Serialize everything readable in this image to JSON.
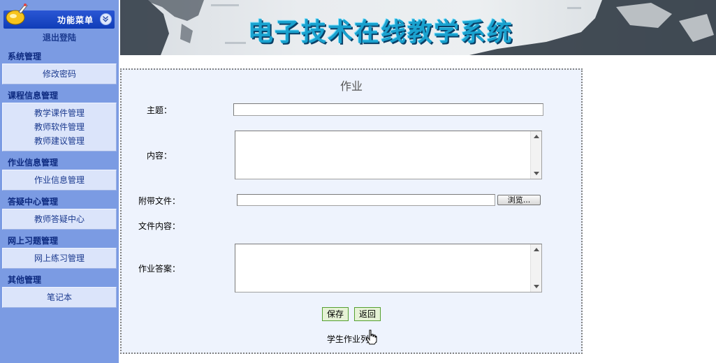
{
  "sidebar": {
    "menu_title": "功能菜单",
    "logout": "退出登陆",
    "sections": [
      {
        "title": "系统管理",
        "items": [
          "修改密码"
        ]
      },
      {
        "title": "课程信息管理",
        "items": [
          "教学课件管理",
          "教师软件管理",
          "教师建议管理"
        ]
      },
      {
        "title": "作业信息管理",
        "items": [
          "作业信息管理"
        ]
      },
      {
        "title": "答疑中心管理",
        "items": [
          "教师答疑中心"
        ]
      },
      {
        "title": "网上习题管理",
        "items": [
          "网上练习管理"
        ]
      },
      {
        "title": "其他管理",
        "items": [
          "笔记本"
        ]
      }
    ]
  },
  "banner": {
    "title": "电子技术在线教学系统"
  },
  "form": {
    "title": "作业",
    "subject_label": "主题：",
    "subject_value": "",
    "content_label": "内容：",
    "content_value": "",
    "attachment_label": "附带文件：",
    "attachment_value": "",
    "browse_button": "浏览...",
    "file_content_label": "文件内容：",
    "answer_label": "作业答案：",
    "answer_value": "",
    "save_button": "保存",
    "back_button": "返回",
    "list_link": "学生作业列表"
  },
  "colors": {
    "sidebar_bg": "#7b9be3",
    "panel_bg": "#eef3fd",
    "banner_title": "#1aa2cf",
    "button_bg": "#e6f2d6"
  }
}
